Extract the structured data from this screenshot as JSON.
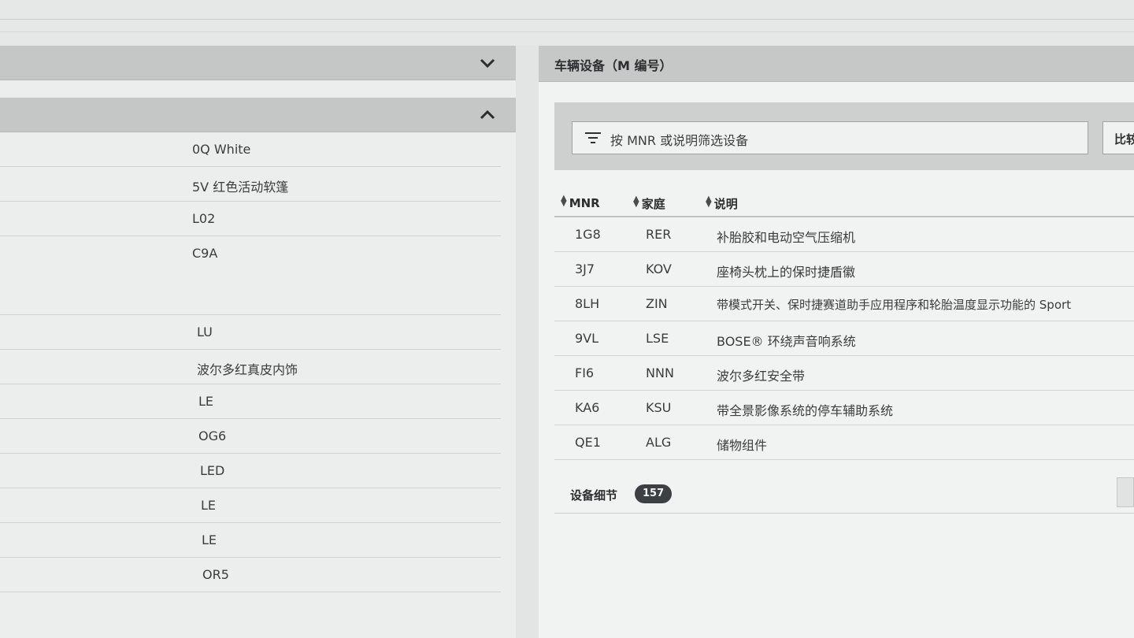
{
  "left_panel": {
    "rows": [
      "0Q White",
      "5V 红色活动软篷",
      "L02",
      "C9A",
      "",
      "LU",
      "波尔多红真皮内饰",
      "LE",
      "OG6",
      "LED",
      "LE",
      "LE",
      "OR5"
    ]
  },
  "right_panel": {
    "title": "车辆设备（M 编号）",
    "filter_placeholder": "按 MNR 或说明筛选设备",
    "compare_label": "比较",
    "columns": {
      "mnr": "MNR",
      "family": "家庭",
      "description": "说明"
    },
    "rows": [
      {
        "mnr": "1G8",
        "family": "RER",
        "description": "补胎胶和电动空气压缩机"
      },
      {
        "mnr": "3J7",
        "family": "KOV",
        "description": "座椅头枕上的保时捷盾徽"
      },
      {
        "mnr": "8LH",
        "family": "ZIN",
        "description": "带模式开关、保时捷赛道助手应用程序和轮胎温度显示功能的 Sport"
      },
      {
        "mnr": "9VL",
        "family": "LSE",
        "description": "BOSE® 环绕声音响系统"
      },
      {
        "mnr": "FI6",
        "family": "NNN",
        "description": "波尔多红安全带"
      },
      {
        "mnr": "KA6",
        "family": "KSU",
        "description": "带全景影像系统的停车辅助系统"
      },
      {
        "mnr": "QE1",
        "family": "ALG",
        "description": "储物组件"
      }
    ],
    "details_label": "设备细节",
    "details_count": "157"
  },
  "icons": {
    "collapse_1": "chevron-down-icon",
    "collapse_2": "chevron-up-icon",
    "filter": "filter-icon",
    "sort": "sort-icon"
  }
}
